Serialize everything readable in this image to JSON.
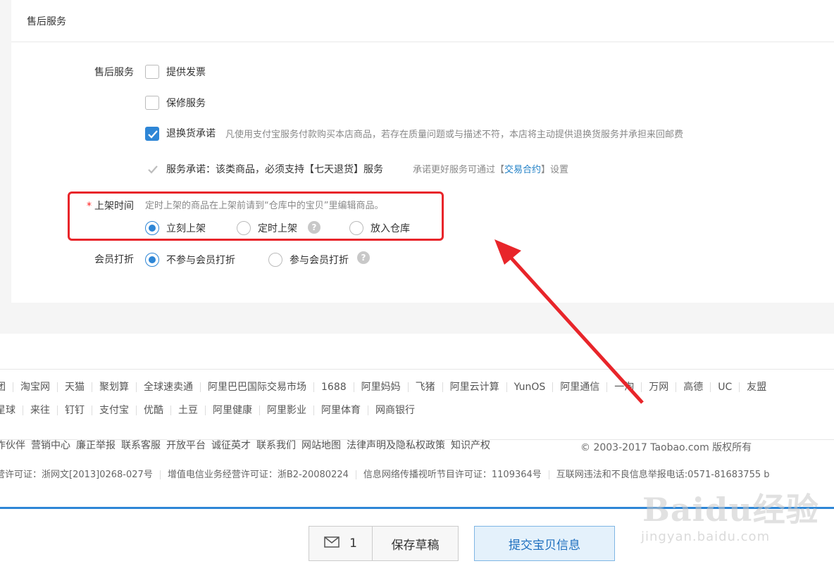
{
  "section_title": "售后服务",
  "after_sales": {
    "label": "售后服务",
    "options": [
      {
        "label": "提供发票",
        "checked": false
      },
      {
        "label": "保修服务",
        "checked": false
      },
      {
        "label": "退换货承诺",
        "checked": true,
        "desc": "凡使用支付宝服务付款购买本店商品，若存在质量问题或与描述不符，本店将主动提供退换货服务并承担来回邮费"
      }
    ],
    "promise": {
      "label": "服务承诺：该类商品，必须支持【七天退货】服务",
      "desc_prefix": "承诺更好服务可通过【",
      "desc_link": "交易合约",
      "desc_suffix": "】设置"
    }
  },
  "listing_time": {
    "required_mark": "*",
    "label": "上架时间",
    "hint": "定时上架的商品在上架前请到“仓库中的宝贝”里编辑商品。",
    "options": [
      {
        "label": "立刻上架",
        "selected": true
      },
      {
        "label": "定时上架",
        "selected": false,
        "help": "?"
      },
      {
        "label": "放入仓库",
        "selected": false
      }
    ]
  },
  "member_discount": {
    "label": "会员打折",
    "options": [
      {
        "label": "不参与会员打折",
        "selected": true
      },
      {
        "label": "参与会员打折",
        "selected": false,
        "help": "?"
      }
    ]
  },
  "footer": {
    "links_row1": [
      "团",
      "淘宝网",
      "天猫",
      "聚划算",
      "全球速卖通",
      "阿里巴巴国际交易市场",
      "1688",
      "阿里妈妈",
      "飞猪",
      "阿里云计算",
      "YunOS",
      "阿里通信",
      "一淘",
      "万网",
      "高德",
      "UC",
      "友盟"
    ],
    "links_row2": [
      "星球",
      "来往",
      "钉钉",
      "支付宝",
      "优酷",
      "土豆",
      "阿里健康",
      "阿里影业",
      "阿里体育",
      "网商银行"
    ],
    "links_row3": [
      "作伙伴",
      "营销中心",
      "廉正举报",
      "联系客服",
      "开放平台",
      "诚征英才",
      "联系我们",
      "网站地图",
      "法律声明及隐私权政策",
      "知识产权"
    ],
    "copyright": "© 2003-2017 Taobao.com 版权所有",
    "licenses": [
      "营许可证：浙网文[2013]0268-027号",
      "增值电信业务经营许可证：浙B2-20080224",
      "信息网络传播视听节目许可证：1109364号",
      "互联网违法和不良信息举报电话:0571-81683755 b"
    ]
  },
  "actions": {
    "message_count": "1",
    "save_draft": "保存草稿",
    "submit": "提交宝贝信息"
  },
  "watermark": {
    "text": "Baidu经验",
    "sub": "jingyan.baidu.com"
  },
  "colors": {
    "accent": "#2e86d6",
    "highlight": "#e8252a",
    "link": "#1e7fc6"
  }
}
